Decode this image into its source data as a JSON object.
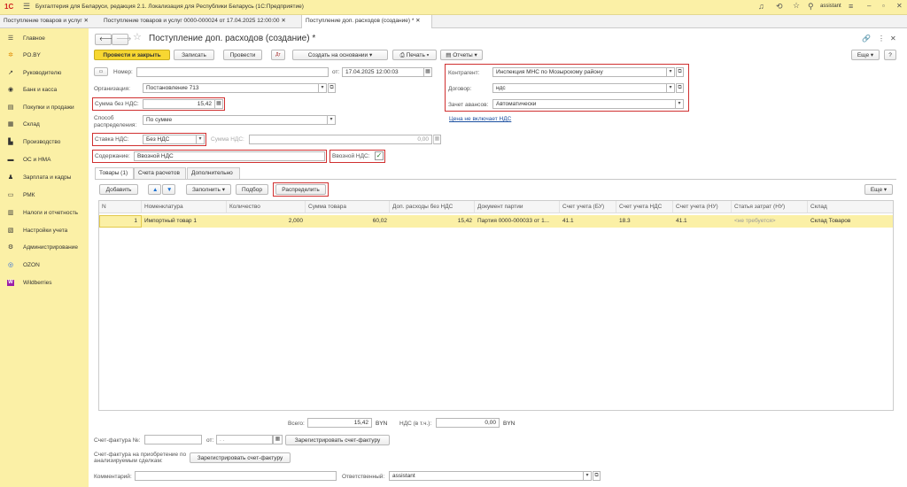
{
  "app": {
    "title": "Бухгалтерия для Беларуси, редакция 2.1. Локализация для Республики Беларусь   (1С:Предприятие)",
    "user": "assistant"
  },
  "open_tabs": [
    "Поступление товаров и услуг",
    "Поступление товаров и услуг 0000-000024 от 17.04.2025 12:00:00",
    "Поступление доп. расходов (создание) *"
  ],
  "sidebar": {
    "items": [
      {
        "label": "Главное",
        "icon": "menu-icon"
      },
      {
        "label": "PO.BY",
        "icon": "sun-icon"
      },
      {
        "label": "Руководителю",
        "icon": "chart-icon"
      },
      {
        "label": "Банк и касса",
        "icon": "bank-icon"
      },
      {
        "label": "Покупки и продажи",
        "icon": "cart-icon"
      },
      {
        "label": "Склад",
        "icon": "warehouse-icon"
      },
      {
        "label": "Производство",
        "icon": "factory-icon"
      },
      {
        "label": "ОС и НМА",
        "icon": "truck-icon"
      },
      {
        "label": "Зарплата и кадры",
        "icon": "people-icon"
      },
      {
        "label": "РМК",
        "icon": "register-icon"
      },
      {
        "label": "Налоги и отчетность",
        "icon": "taxes-icon"
      },
      {
        "label": "Настройки учета",
        "icon": "settings-icon"
      },
      {
        "label": "Администрирование",
        "icon": "gear-icon"
      },
      {
        "label": "OZON",
        "icon": "ozon-icon"
      },
      {
        "label": "Wildberries",
        "icon": "wildberries-icon"
      }
    ]
  },
  "form": {
    "title": "Поступление доп. расходов (создание) *",
    "toolbar": {
      "post_close": "Провести и закрыть",
      "save": "Записать",
      "post": "Провести",
      "create_based": "Создать на основании",
      "print": "Печать",
      "reports": "Отчеты",
      "more": "Еще"
    },
    "number_label": "Номер:",
    "number_value": "",
    "date_label": "от:",
    "date_value": "17.04.2025 12:00:03",
    "org_label": "Организация:",
    "org_value": "Постановление 713",
    "sum_label": "Сумма без НДС:",
    "sum_value": "15,42",
    "method_label": "Способ распределения:",
    "method_value": "По сумме",
    "vat_rate_label": "Ставка НДС:",
    "vat_rate_value": "Без НДС",
    "vat_sum_label": "Сумма НДС:",
    "vat_sum_value": "0,00",
    "content_label": "Содержание:",
    "content_value": "Ввозной НДС",
    "import_vat_label": "Ввозной НДС:",
    "counterparty_label": "Контрагент:",
    "counterparty_value": "Инспекция МНС по Мозырскому району",
    "contract_label": "Договор:",
    "contract_value": "ндс",
    "advance_label": "Зачет авансов:",
    "advance_value": "Автоматически",
    "price_link": "Цена не включает НДС"
  },
  "tabs": [
    "Товары (1)",
    "Счета расчетов",
    "Дополнительно"
  ],
  "table_toolbar": {
    "add": "Добавить",
    "fill": "Заполнить",
    "select": "Подбор",
    "distribute": "Распределить",
    "more": "Еще"
  },
  "table": {
    "columns": [
      "N",
      "Номенклатура",
      "Количество",
      "Сумма товара",
      "Доп. расходы без НДС",
      "Документ партии",
      "Счет учета (БУ)",
      "Счет учета НДС",
      "Счет учета (НУ)",
      "Статья затрат (НУ)",
      "Склад"
    ],
    "rows": [
      [
        "1",
        "Импортный товар 1",
        "2,000",
        "60,02",
        "15,42",
        "Партия 0000-000033 от 1...",
        "41.1",
        "18.3",
        "41.1",
        "<не требуется>",
        "Склад Товаров"
      ]
    ]
  },
  "totals": {
    "total_label": "Всего:",
    "total_value": "15,42",
    "currency": "BYN",
    "vat_label": "НДС (в т.ч.):",
    "vat_value": "0,00",
    "currency2": "BYN"
  },
  "footer": {
    "invoice_label": "Счет-фактура №:",
    "invoice_date_label": "от:",
    "invoice_date_placeholder": ". .",
    "register_invoice": "Зарегистрировать счет-фактуру",
    "invoice2_label": "Счет-фактура на приобретение по анализируемым сделкам:",
    "register_invoice2": "Зарегистрировать счет-фактуру",
    "comment_label": "Комментарий:",
    "comment_value": "",
    "responsible_label": "Ответственный:",
    "responsible_value": "assistant"
  }
}
